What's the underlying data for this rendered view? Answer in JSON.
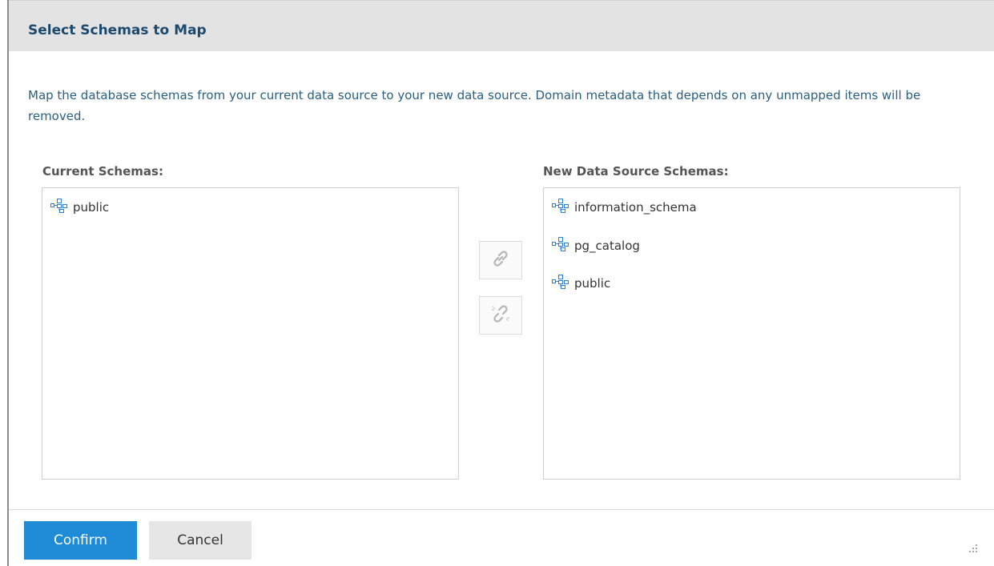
{
  "dialog": {
    "title": "Select Schemas to Map",
    "description": "Map the database schemas from your current data source to your new data source. Domain metadata that depends on any unmapped items will be removed."
  },
  "current_schemas": {
    "label": "Current Schemas:",
    "items": [
      "public"
    ]
  },
  "new_schemas": {
    "label": "New Data Source Schemas:",
    "items": [
      "information_schema",
      "pg_catalog",
      "public"
    ]
  },
  "actions": {
    "link_icon": "link-icon",
    "unlink_icon": "unlink-icon"
  },
  "footer": {
    "confirm_label": "Confirm",
    "cancel_label": "Cancel"
  },
  "colors": {
    "title": "#1c4a6e",
    "description": "#2a5f80",
    "primary_button": "#1f8bd6",
    "schema_icon": "#2a7fd4"
  }
}
